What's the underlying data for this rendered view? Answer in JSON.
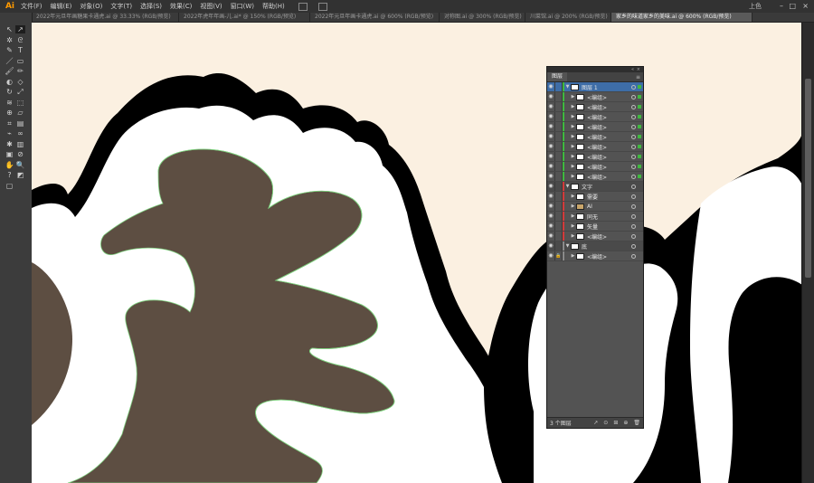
{
  "app": {
    "logo": "Ai"
  },
  "menu": [
    "文件(F)",
    "编辑(E)",
    "对象(O)",
    "文字(T)",
    "选择(S)",
    "效果(C)",
    "视图(V)",
    "窗口(W)",
    "帮助(H)"
  ],
  "workspace": "上色",
  "window_controls": {
    "minimize": "–",
    "maximize": "□",
    "close": "×"
  },
  "tabs": [
    {
      "label": "2022年元旦年画糖果卡通虎.ai @ 33.33% (RGB/预览)",
      "active": false
    },
    {
      "label": "2022年虎年年画-儿.ai* @ 150% (RGB/预览)",
      "active": false
    },
    {
      "label": "2022年元旦年画卡通虎.ai @ 600% (RGB/预览)",
      "active": false
    },
    {
      "label": "对称图.ai @ 300% (RGB/预览)",
      "active": false
    },
    {
      "label": "川菜馆.ai @ 200% (RGB/预览)",
      "active": false
    },
    {
      "label": "家乡的味道家乡的美味.ai @ 600% (RGB/预览)",
      "active": true
    }
  ],
  "colors": {
    "canvas_bg": "#fbf0e1",
    "brown_fill": "#5d4e42",
    "black": "#000000",
    "white": "#ffffff",
    "path_highlight": "#7ed17e",
    "layer_green": "#3fb93f",
    "layer_red": "#d23b3b",
    "layer_gray": "#8a8a8a",
    "selection_blue": "#3e6da7"
  },
  "tools": [
    "selection-icon",
    "direct-selection-icon",
    "magic-wand-icon",
    "lasso-icon",
    "pen-icon",
    "type-icon",
    "line-icon",
    "rectangle-icon",
    "paintbrush-icon",
    "pencil-icon",
    "blob-brush-icon",
    "eraser-icon",
    "rotate-icon",
    "scale-icon",
    "width-icon",
    "free-transform-icon",
    "shape-builder-icon",
    "perspective-icon",
    "mesh-icon",
    "gradient-icon",
    "eyedropper-icon",
    "blend-icon",
    "symbol-sprayer-icon",
    "column-graph-icon",
    "artboard-icon",
    "slice-icon",
    "hand-icon",
    "zoom-icon",
    "help-icon",
    "fill-stroke-icon",
    "screen-mode-icon"
  ],
  "tool_glyphs": [
    "↖",
    "↗",
    "✲",
    "ᘓ",
    "✎",
    "T",
    "／",
    "▭",
    "🖌",
    "✏",
    "◐",
    "◇",
    "↻",
    "⤢",
    "≋",
    "⬚",
    "⊕",
    "▱",
    "⌗",
    "▤",
    "⌁",
    "∞",
    "✱",
    "▥",
    "▣",
    "⊘",
    "✋",
    "🔍",
    "?",
    "◩",
    "▢"
  ],
  "layers_panel": {
    "tab_label": "图层",
    "menu_icon": "≡",
    "footer_count": "3 个图层",
    "footer_buttons": [
      "↗",
      "⊙",
      "⊞",
      "⊕",
      "🗑"
    ],
    "rows": [
      {
        "label": "图层 1",
        "indent": 0,
        "expanded": true,
        "color": "green",
        "thumb": "white",
        "kind": "layer"
      },
      {
        "label": "<编组>",
        "indent": 1,
        "expanded": false,
        "color": "green",
        "thumb": "white"
      },
      {
        "label": "<编组>",
        "indent": 1,
        "expanded": false,
        "color": "green",
        "thumb": "white"
      },
      {
        "label": "<编组>",
        "indent": 1,
        "expanded": false,
        "color": "green",
        "thumb": "white"
      },
      {
        "label": "<编组>",
        "indent": 1,
        "expanded": false,
        "color": "green",
        "thumb": "white"
      },
      {
        "label": "<编组>",
        "indent": 1,
        "expanded": false,
        "color": "green",
        "thumb": "white"
      },
      {
        "label": "<编组>",
        "indent": 1,
        "expanded": false,
        "color": "green",
        "thumb": "white"
      },
      {
        "label": "<编组>",
        "indent": 1,
        "expanded": false,
        "color": "green",
        "thumb": "white"
      },
      {
        "label": "<编组>",
        "indent": 1,
        "expanded": false,
        "color": "green",
        "thumb": "white"
      },
      {
        "label": "<编组>",
        "indent": 1,
        "expanded": false,
        "color": "green",
        "thumb": "white"
      },
      {
        "label": "文字",
        "indent": 0,
        "expanded": true,
        "color": "red",
        "thumb": "white",
        "kind": "layer"
      },
      {
        "label": "需要",
        "indent": 1,
        "expanded": false,
        "color": "red",
        "thumb": "white"
      },
      {
        "label": "AI",
        "indent": 1,
        "expanded": false,
        "color": "red",
        "thumb": "art"
      },
      {
        "label": "同无",
        "indent": 1,
        "expanded": false,
        "color": "red",
        "thumb": "white"
      },
      {
        "label": "矢量",
        "indent": 1,
        "expanded": false,
        "color": "red",
        "thumb": "white"
      },
      {
        "label": "<编组>",
        "indent": 1,
        "expanded": false,
        "color": "red",
        "thumb": "white"
      },
      {
        "label": "底",
        "indent": 0,
        "expanded": true,
        "color": "gray",
        "thumb": "white",
        "kind": "layer"
      },
      {
        "label": "<编组>",
        "indent": 1,
        "expanded": false,
        "color": "gray",
        "thumb": "white",
        "locked": true
      }
    ]
  }
}
